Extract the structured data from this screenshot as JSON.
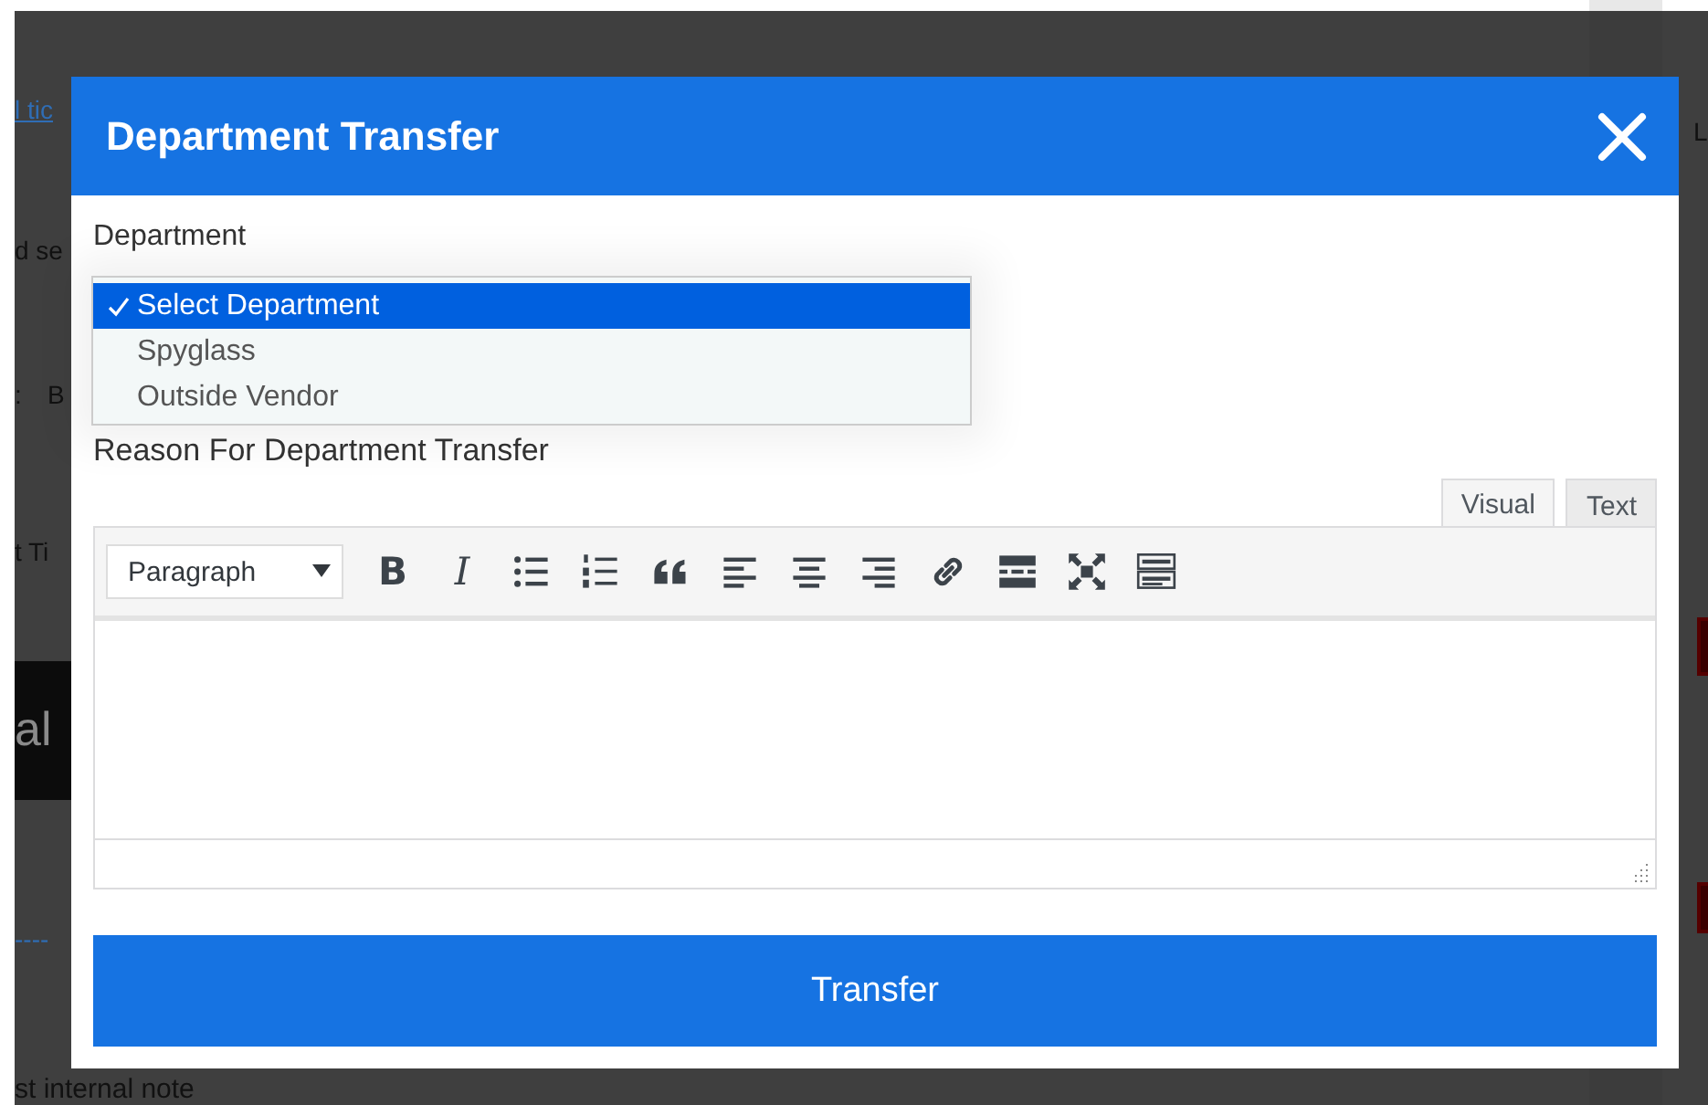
{
  "background_page": {
    "left_texts": [
      {
        "kind": "link",
        "text": "l tic"
      },
      {
        "kind": "text",
        "text": "d se"
      },
      {
        "kind": "text",
        "text": ":"
      },
      {
        "kind": "text",
        "text": "B"
      },
      {
        "kind": "text",
        "text": "t Ti"
      },
      {
        "kind": "banner",
        "text": "al"
      },
      {
        "kind": "link",
        "text": "----"
      }
    ],
    "bottom_text": "st internal note",
    "right_texts": [
      "L"
    ]
  },
  "dialog": {
    "title": "Department Transfer",
    "department": {
      "label": "Department",
      "options": [
        {
          "label": "Select Department",
          "selected": true
        },
        {
          "label": "Spyglass",
          "selected": false
        },
        {
          "label": "Outside Vendor",
          "selected": false
        }
      ]
    },
    "reason": {
      "label": "Reason For Department Transfer",
      "tabs": [
        {
          "label": "Visual",
          "selected": true
        },
        {
          "label": "Text",
          "selected": false
        }
      ],
      "toolbar": {
        "format": "Paragraph",
        "bold": "B",
        "italic": "I"
      }
    },
    "submit": "Transfer"
  }
}
